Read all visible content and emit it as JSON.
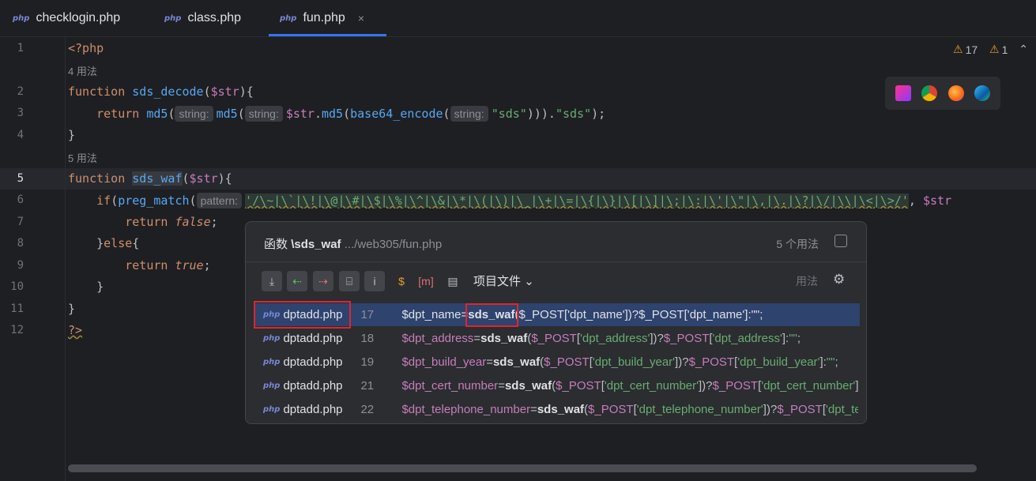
{
  "tabs": [
    {
      "label": "checklogin.php",
      "icon": "php-file-icon",
      "active": false
    },
    {
      "label": "class.php",
      "icon": "php-file-icon",
      "active": false
    },
    {
      "label": "fun.php",
      "icon": "php-file-icon",
      "active": true
    }
  ],
  "php_badge": "php",
  "close_glyph": "×",
  "editor": {
    "line_numbers": [
      "1",
      "2",
      "3",
      "4",
      "5",
      "6",
      "7",
      "8",
      "9",
      "10",
      "11",
      "12"
    ],
    "usage_hints": [
      "4 用法",
      "5 用法"
    ],
    "param_hints": {
      "string": "string:",
      "pattern": "pattern:"
    },
    "code": {
      "open_tag": "<?php",
      "kw_function": "function",
      "sds_decode": "sds_decode",
      "sds_waf": "sds_waf",
      "arg": "$str",
      "kw_return": "return",
      "md5": "md5",
      "base64": "base64_encode",
      "sds_str": "\"sds\"",
      "preg_match": "preg_match",
      "regex": "'/\\~|\\`|\\!|\\@|\\#|\\$|\\%|\\^|\\&|\\*|\\(|\\)|\\_|\\+|\\=|\\{|\\}|\\[|\\]|\\;|\\:|\\'|\\\"|\\,|\\.|\\?|\\/|\\\\|\\<|\\>/'",
      "kw_if": "if",
      "kw_else": "else",
      "kw_false": "false",
      "kw_true": "true",
      "close_tag": "?>"
    },
    "warnings": {
      "count1": "17",
      "count2": "1"
    }
  },
  "browser_icons": [
    "phpstorm-icon",
    "chrome-icon",
    "firefox-icon",
    "edge-icon"
  ],
  "popup": {
    "title_prefix": "函数",
    "title_name": "\\sds_waf",
    "path": ".../web305/fun.php",
    "count": "5 个用法",
    "scope": "项目文件",
    "uses_label": "用法",
    "rows": [
      {
        "file": "dptadd.php",
        "line": "17",
        "var": "$dpt_name",
        "key": "dpt_name",
        "selected": true
      },
      {
        "file": "dptadd.php",
        "line": "18",
        "var": "$dpt_address",
        "key": "dpt_address",
        "selected": false
      },
      {
        "file": "dptadd.php",
        "line": "19",
        "var": "$dpt_build_year",
        "key": "dpt_build_year",
        "selected": false
      },
      {
        "file": "dptadd.php",
        "line": "21",
        "var": "$dpt_cert_number",
        "key": "dpt_cert_number",
        "selected": false
      },
      {
        "file": "dptadd.php",
        "line": "22",
        "var": "$dpt_telephone_number",
        "key": "dpt_telephone_number",
        "selected": false
      }
    ]
  },
  "colors": {
    "accent": "#3574f0",
    "selection": "#2e436e",
    "annotation_red": "#e0252b"
  }
}
